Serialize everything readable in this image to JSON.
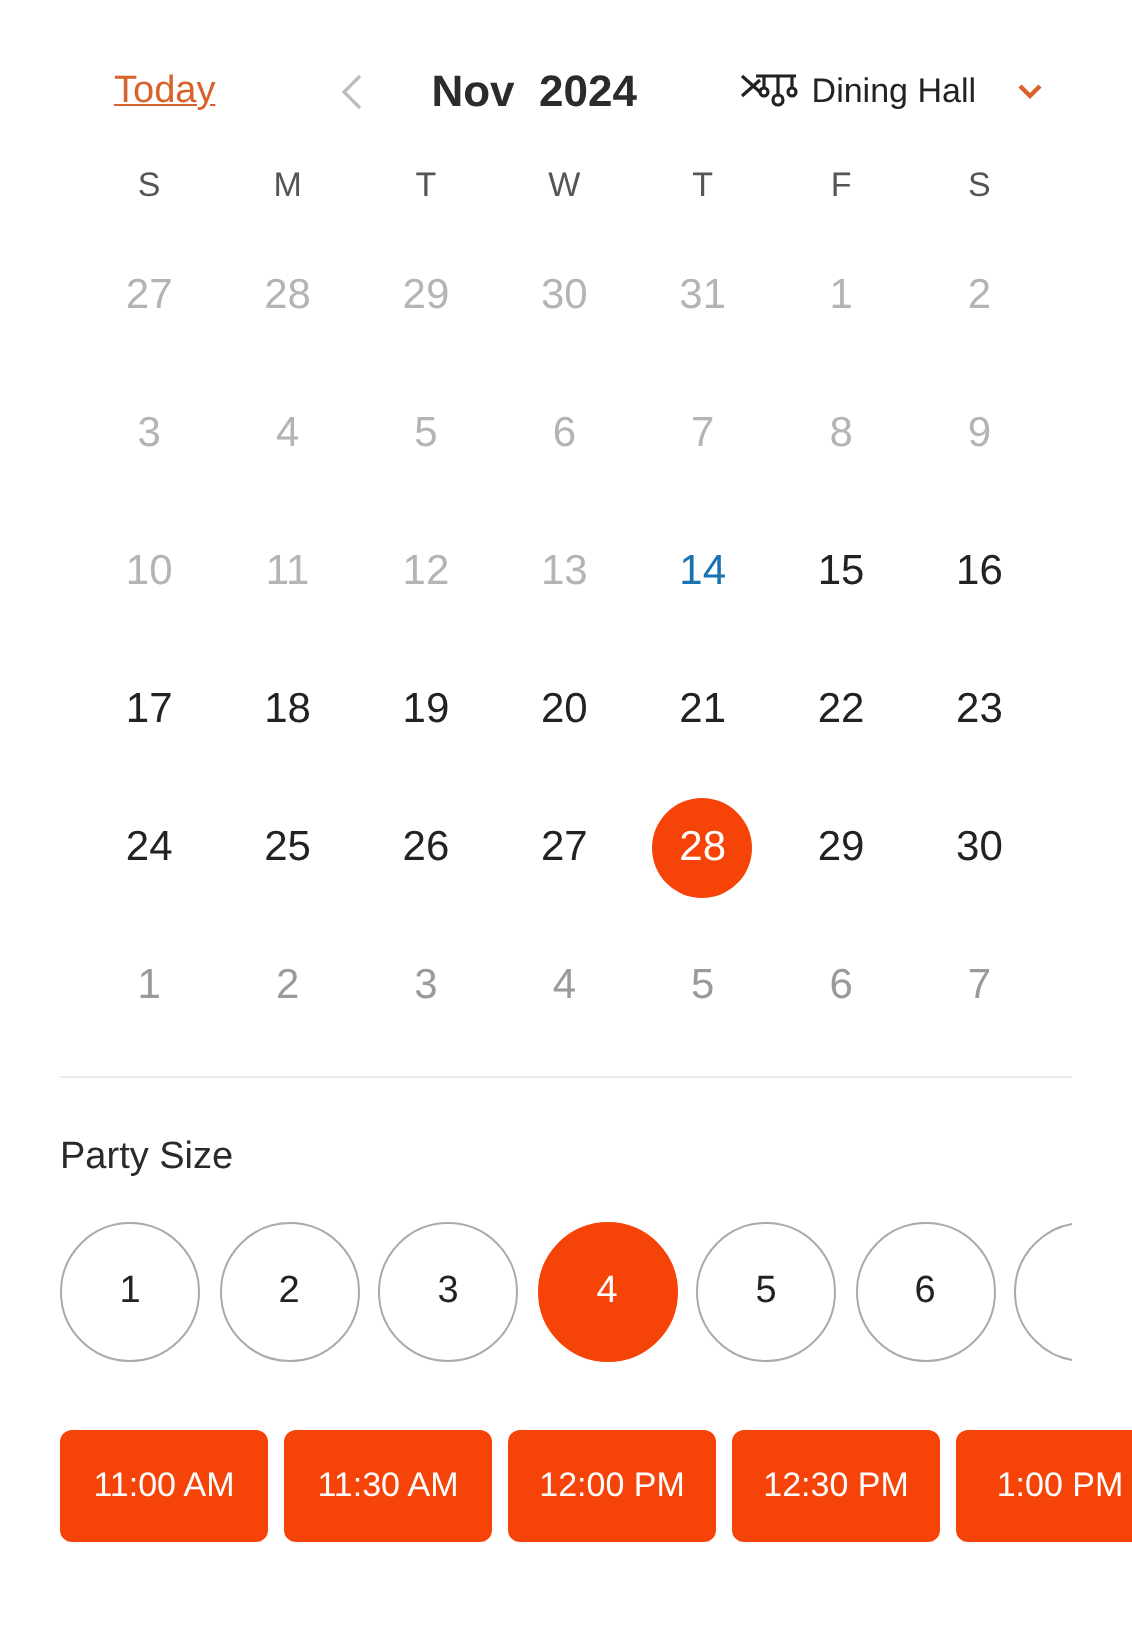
{
  "header": {
    "today_link": "Today",
    "month": "Nov  2024",
    "venue": "Dining Hall"
  },
  "weekdays": [
    "S",
    "M",
    "T",
    "W",
    "T",
    "F",
    "S"
  ],
  "weeks": [
    [
      {
        "day": "27",
        "kind": "muted",
        "selected": false
      },
      {
        "day": "28",
        "kind": "muted",
        "selected": false
      },
      {
        "day": "29",
        "kind": "muted",
        "selected": false
      },
      {
        "day": "30",
        "kind": "muted",
        "selected": false
      },
      {
        "day": "31",
        "kind": "muted",
        "selected": false
      },
      {
        "day": "1",
        "kind": "muted",
        "selected": false
      },
      {
        "day": "2",
        "kind": "muted",
        "selected": false
      }
    ],
    [
      {
        "day": "3",
        "kind": "muted",
        "selected": false
      },
      {
        "day": "4",
        "kind": "muted",
        "selected": false
      },
      {
        "day": "5",
        "kind": "muted",
        "selected": false
      },
      {
        "day": "6",
        "kind": "muted",
        "selected": false
      },
      {
        "day": "7",
        "kind": "muted",
        "selected": false
      },
      {
        "day": "8",
        "kind": "muted",
        "selected": false
      },
      {
        "day": "9",
        "kind": "muted",
        "selected": false
      }
    ],
    [
      {
        "day": "10",
        "kind": "muted",
        "selected": false
      },
      {
        "day": "11",
        "kind": "muted",
        "selected": false
      },
      {
        "day": "12",
        "kind": "muted",
        "selected": false
      },
      {
        "day": "13",
        "kind": "muted",
        "selected": false
      },
      {
        "day": "14",
        "kind": "today",
        "selected": false
      },
      {
        "day": "15",
        "kind": "normal",
        "selected": false
      },
      {
        "day": "16",
        "kind": "normal",
        "selected": false
      }
    ],
    [
      {
        "day": "17",
        "kind": "normal",
        "selected": false
      },
      {
        "day": "18",
        "kind": "normal",
        "selected": false
      },
      {
        "day": "19",
        "kind": "normal",
        "selected": false
      },
      {
        "day": "20",
        "kind": "normal",
        "selected": false
      },
      {
        "day": "21",
        "kind": "normal",
        "selected": false
      },
      {
        "day": "22",
        "kind": "normal",
        "selected": false
      },
      {
        "day": "23",
        "kind": "normal",
        "selected": false
      }
    ],
    [
      {
        "day": "24",
        "kind": "normal",
        "selected": false
      },
      {
        "day": "25",
        "kind": "normal",
        "selected": false
      },
      {
        "day": "26",
        "kind": "normal",
        "selected": false
      },
      {
        "day": "27",
        "kind": "normal",
        "selected": false
      },
      {
        "day": "28",
        "kind": "normal",
        "selected": true
      },
      {
        "day": "29",
        "kind": "normal",
        "selected": false
      },
      {
        "day": "30",
        "kind": "normal",
        "selected": false
      }
    ],
    [
      {
        "day": "1",
        "kind": "next",
        "selected": false
      },
      {
        "day": "2",
        "kind": "next",
        "selected": false
      },
      {
        "day": "3",
        "kind": "next",
        "selected": false
      },
      {
        "day": "4",
        "kind": "next",
        "selected": false
      },
      {
        "day": "5",
        "kind": "next",
        "selected": false
      },
      {
        "day": "6",
        "kind": "next",
        "selected": false
      },
      {
        "day": "7",
        "kind": "next",
        "selected": false
      }
    ]
  ],
  "party_size": {
    "label": "Party Size",
    "options": [
      {
        "label": "1",
        "selected": false
      },
      {
        "label": "2",
        "selected": false
      },
      {
        "label": "3",
        "selected": false
      },
      {
        "label": "4",
        "selected": true
      },
      {
        "label": "5",
        "selected": false
      },
      {
        "label": "6",
        "selected": false
      },
      {
        "selected": false
      }
    ]
  },
  "time_slots": [
    "11:00 AM",
    "11:30 AM",
    "12:00 PM",
    "12:30 PM",
    "1:00 PM"
  ]
}
